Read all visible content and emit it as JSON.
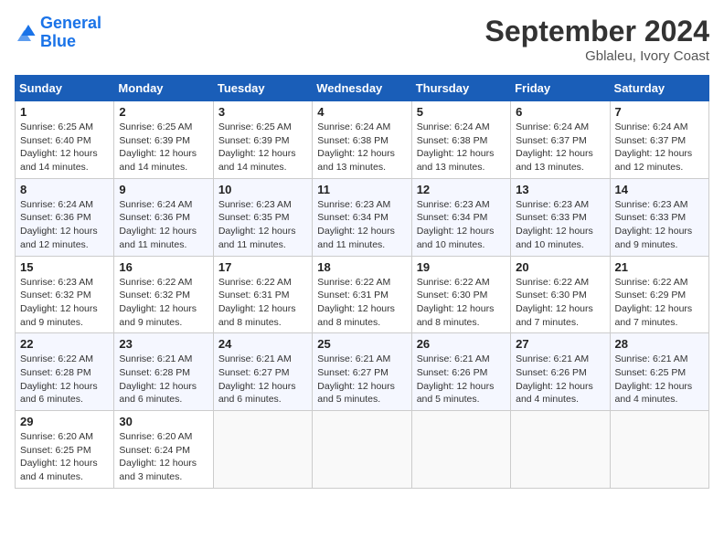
{
  "logo": {
    "line1": "General",
    "line2": "Blue"
  },
  "title": "September 2024",
  "location": "Gblaleu, Ivory Coast",
  "days_header": [
    "Sunday",
    "Monday",
    "Tuesday",
    "Wednesday",
    "Thursday",
    "Friday",
    "Saturday"
  ],
  "weeks": [
    [
      {
        "day": "1",
        "info": "Sunrise: 6:25 AM\nSunset: 6:40 PM\nDaylight: 12 hours\nand 14 minutes."
      },
      {
        "day": "2",
        "info": "Sunrise: 6:25 AM\nSunset: 6:39 PM\nDaylight: 12 hours\nand 14 minutes."
      },
      {
        "day": "3",
        "info": "Sunrise: 6:25 AM\nSunset: 6:39 PM\nDaylight: 12 hours\nand 14 minutes."
      },
      {
        "day": "4",
        "info": "Sunrise: 6:24 AM\nSunset: 6:38 PM\nDaylight: 12 hours\nand 13 minutes."
      },
      {
        "day": "5",
        "info": "Sunrise: 6:24 AM\nSunset: 6:38 PM\nDaylight: 12 hours\nand 13 minutes."
      },
      {
        "day": "6",
        "info": "Sunrise: 6:24 AM\nSunset: 6:37 PM\nDaylight: 12 hours\nand 13 minutes."
      },
      {
        "day": "7",
        "info": "Sunrise: 6:24 AM\nSunset: 6:37 PM\nDaylight: 12 hours\nand 12 minutes."
      }
    ],
    [
      {
        "day": "8",
        "info": "Sunrise: 6:24 AM\nSunset: 6:36 PM\nDaylight: 12 hours\nand 12 minutes."
      },
      {
        "day": "9",
        "info": "Sunrise: 6:24 AM\nSunset: 6:36 PM\nDaylight: 12 hours\nand 11 minutes."
      },
      {
        "day": "10",
        "info": "Sunrise: 6:23 AM\nSunset: 6:35 PM\nDaylight: 12 hours\nand 11 minutes."
      },
      {
        "day": "11",
        "info": "Sunrise: 6:23 AM\nSunset: 6:34 PM\nDaylight: 12 hours\nand 11 minutes."
      },
      {
        "day": "12",
        "info": "Sunrise: 6:23 AM\nSunset: 6:34 PM\nDaylight: 12 hours\nand 10 minutes."
      },
      {
        "day": "13",
        "info": "Sunrise: 6:23 AM\nSunset: 6:33 PM\nDaylight: 12 hours\nand 10 minutes."
      },
      {
        "day": "14",
        "info": "Sunrise: 6:23 AM\nSunset: 6:33 PM\nDaylight: 12 hours\nand 9 minutes."
      }
    ],
    [
      {
        "day": "15",
        "info": "Sunrise: 6:23 AM\nSunset: 6:32 PM\nDaylight: 12 hours\nand 9 minutes."
      },
      {
        "day": "16",
        "info": "Sunrise: 6:22 AM\nSunset: 6:32 PM\nDaylight: 12 hours\nand 9 minutes."
      },
      {
        "day": "17",
        "info": "Sunrise: 6:22 AM\nSunset: 6:31 PM\nDaylight: 12 hours\nand 8 minutes."
      },
      {
        "day": "18",
        "info": "Sunrise: 6:22 AM\nSunset: 6:31 PM\nDaylight: 12 hours\nand 8 minutes."
      },
      {
        "day": "19",
        "info": "Sunrise: 6:22 AM\nSunset: 6:30 PM\nDaylight: 12 hours\nand 8 minutes."
      },
      {
        "day": "20",
        "info": "Sunrise: 6:22 AM\nSunset: 6:30 PM\nDaylight: 12 hours\nand 7 minutes."
      },
      {
        "day": "21",
        "info": "Sunrise: 6:22 AM\nSunset: 6:29 PM\nDaylight: 12 hours\nand 7 minutes."
      }
    ],
    [
      {
        "day": "22",
        "info": "Sunrise: 6:22 AM\nSunset: 6:28 PM\nDaylight: 12 hours\nand 6 minutes."
      },
      {
        "day": "23",
        "info": "Sunrise: 6:21 AM\nSunset: 6:28 PM\nDaylight: 12 hours\nand 6 minutes."
      },
      {
        "day": "24",
        "info": "Sunrise: 6:21 AM\nSunset: 6:27 PM\nDaylight: 12 hours\nand 6 minutes."
      },
      {
        "day": "25",
        "info": "Sunrise: 6:21 AM\nSunset: 6:27 PM\nDaylight: 12 hours\nand 5 minutes."
      },
      {
        "day": "26",
        "info": "Sunrise: 6:21 AM\nSunset: 6:26 PM\nDaylight: 12 hours\nand 5 minutes."
      },
      {
        "day": "27",
        "info": "Sunrise: 6:21 AM\nSunset: 6:26 PM\nDaylight: 12 hours\nand 4 minutes."
      },
      {
        "day": "28",
        "info": "Sunrise: 6:21 AM\nSunset: 6:25 PM\nDaylight: 12 hours\nand 4 minutes."
      }
    ],
    [
      {
        "day": "29",
        "info": "Sunrise: 6:20 AM\nSunset: 6:25 PM\nDaylight: 12 hours\nand 4 minutes."
      },
      {
        "day": "30",
        "info": "Sunrise: 6:20 AM\nSunset: 6:24 PM\nDaylight: 12 hours\nand 3 minutes."
      },
      {
        "day": "",
        "info": ""
      },
      {
        "day": "",
        "info": ""
      },
      {
        "day": "",
        "info": ""
      },
      {
        "day": "",
        "info": ""
      },
      {
        "day": "",
        "info": ""
      }
    ]
  ]
}
